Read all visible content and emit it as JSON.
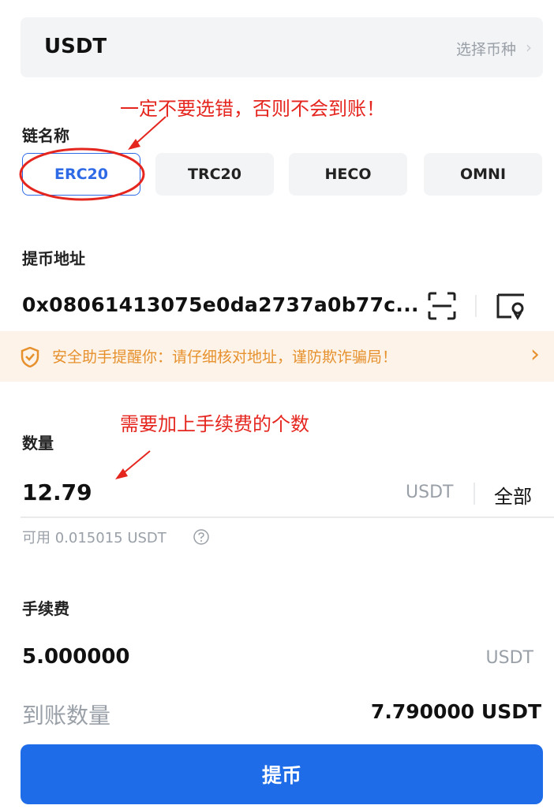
{
  "coin": {
    "name": "USDT",
    "select_label": "选择币种",
    "chevron": "›"
  },
  "chain": {
    "label": "链名称",
    "options": [
      "ERC20",
      "TRC20",
      "HECO",
      "OMNI"
    ],
    "selected": "ERC20"
  },
  "annotations": {
    "top_note": "一定不要选错，否则不会到账！",
    "amount_note": "需要加上手续费的个数",
    "color": "#e5261f"
  },
  "address": {
    "label": "提币地址",
    "value": "0x08061413075e0da2737a0b77c..."
  },
  "warning": {
    "text": "安全助手提醒你：请仔细核对地址，谨防欺诈骗局！",
    "chevron": "›"
  },
  "amount": {
    "label": "数量",
    "value": "12.79",
    "unit": "USDT",
    "all_label": "全部",
    "available": "可用 0.015015 USDT"
  },
  "fee": {
    "label": "手续费",
    "value": "5.000000",
    "unit": "USDT"
  },
  "arrival": {
    "label": "到账数量",
    "value": "7.790000 USDT"
  },
  "submit_label": "提币",
  "colors": {
    "primary": "#1f6ce8",
    "warning": "#e6912e",
    "annotation": "#e5261f"
  }
}
